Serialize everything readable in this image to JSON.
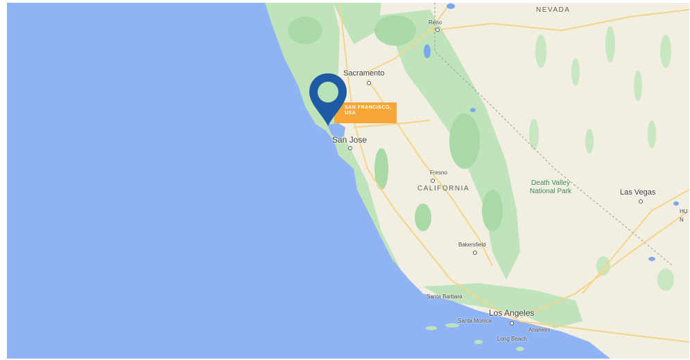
{
  "map": {
    "colors": {
      "ocean": "#8fb3f5",
      "land": "#f3eee2",
      "vegetation": "#b7e1b6",
      "road": "#f4d487",
      "lake": "#7ba7ef",
      "marker": "#1f5ba4",
      "tag": "#f6a537"
    },
    "marker": {
      "icon": "map-pin-icon",
      "label_line1": "SAN FRANCISCO,",
      "label_line2": "USA"
    },
    "labels": {
      "nevada": "NEVADA",
      "california": "CALIFORNIA",
      "reno": "Reno",
      "sacramento": "Sacramento",
      "san_jose": "San Jose",
      "fresno": "Fresno",
      "bakersfield": "Bakersfield",
      "death_valley_1": "Death Valley",
      "death_valley_2": "National Park",
      "las_vegas": "Las Vegas",
      "edge_fragment_1": "HU",
      "edge_fragment_2": "N",
      "santa_barbara": "Santa Barbara",
      "los_angeles": "Los Angeles",
      "santa_monica": "Santa Monica",
      "anaheim": "Anaheim",
      "long_beach": "Long Beach"
    }
  }
}
